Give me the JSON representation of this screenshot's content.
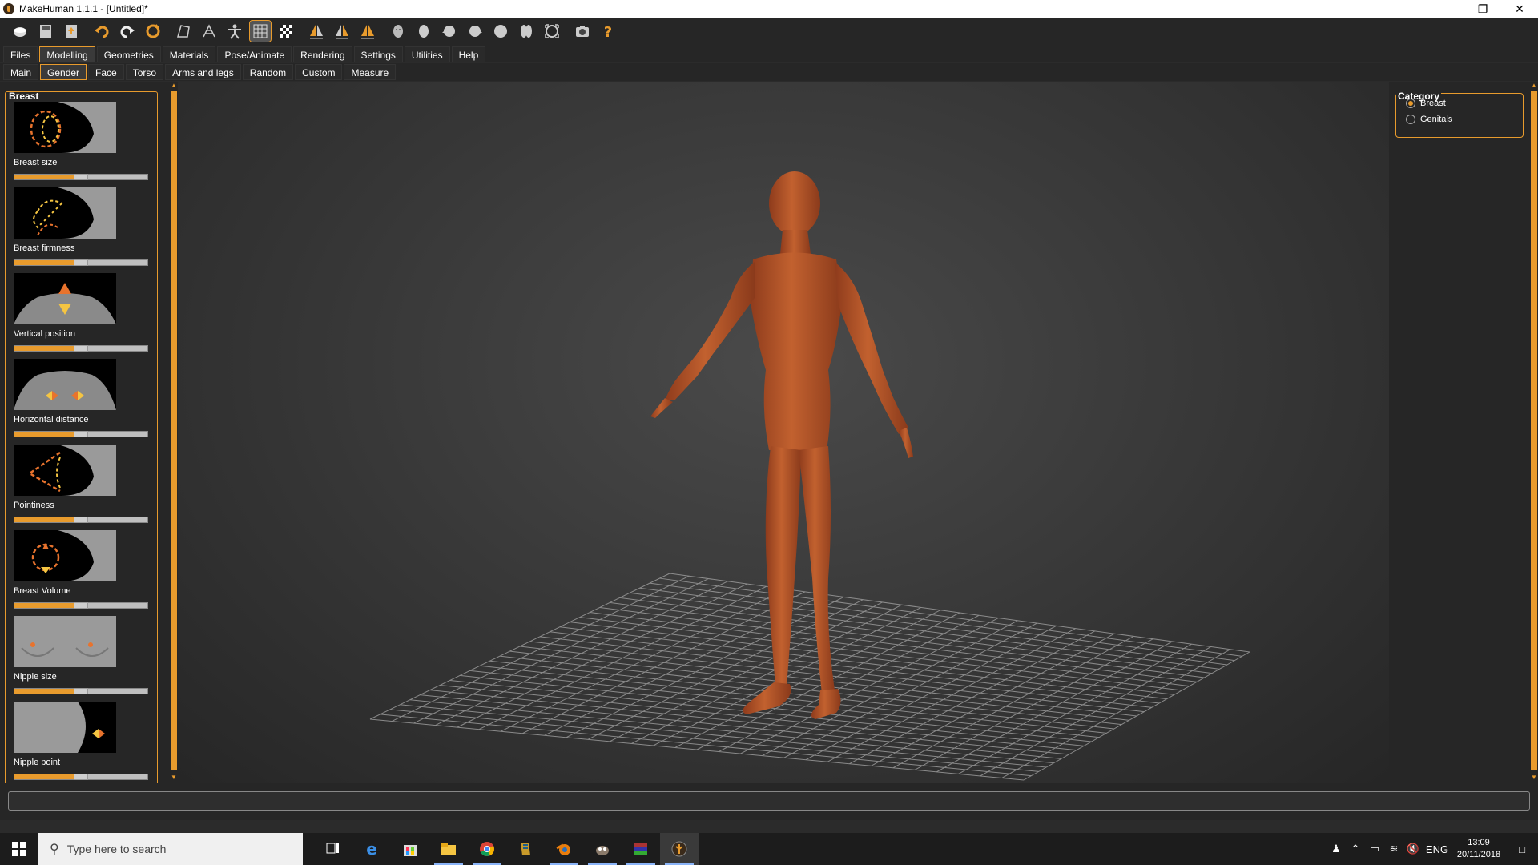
{
  "window": {
    "title": "MakeHuman 1.1.1 - [Untitled]*"
  },
  "toolbar": {
    "icons": [
      "new-file",
      "save",
      "export",
      "undo",
      "redo",
      "reset",
      "smooth",
      "wireframe",
      "pose",
      "grid",
      "checker",
      "symmetry-left",
      "symmetry-right",
      "symmetry",
      "front-view",
      "back-view",
      "left-view",
      "right-view",
      "top-view",
      "bottom-view",
      "reset-camera",
      "screenshot",
      "help"
    ]
  },
  "main_tabs": [
    "Files",
    "Modelling",
    "Geometries",
    "Materials",
    "Pose/Animate",
    "Rendering",
    "Settings",
    "Utilities",
    "Help"
  ],
  "main_tab_active": "Modelling",
  "sub_tabs": [
    "Main",
    "Gender",
    "Face",
    "Torso",
    "Arms and legs",
    "Random",
    "Custom",
    "Measure"
  ],
  "sub_tab_active": "Gender",
  "left_panel": {
    "title": "Breast",
    "sliders": [
      {
        "label": "Breast size",
        "value": 0.5
      },
      {
        "label": "Breast firmness",
        "value": 0.5
      },
      {
        "label": "Vertical position",
        "value": 0.5
      },
      {
        "label": "Horizontal distance",
        "value": 0.5
      },
      {
        "label": "Pointiness",
        "value": 0.5
      },
      {
        "label": "Breast Volume",
        "value": 0.5
      },
      {
        "label": "Nipple size",
        "value": 0.5
      },
      {
        "label": "Nipple point",
        "value": 0.5
      }
    ]
  },
  "right_panel": {
    "title": "Category",
    "options": [
      {
        "label": "Breast",
        "checked": true
      },
      {
        "label": "Genitals",
        "checked": false
      }
    ]
  },
  "status": {
    "text": ""
  },
  "taskbar": {
    "search_placeholder": "Type here to search",
    "language": "ENG",
    "time": "13:09",
    "date": "20/11/2018"
  },
  "colors": {
    "accent": "#e89b2d",
    "skin": "#b5532a",
    "bg": "#262626"
  }
}
